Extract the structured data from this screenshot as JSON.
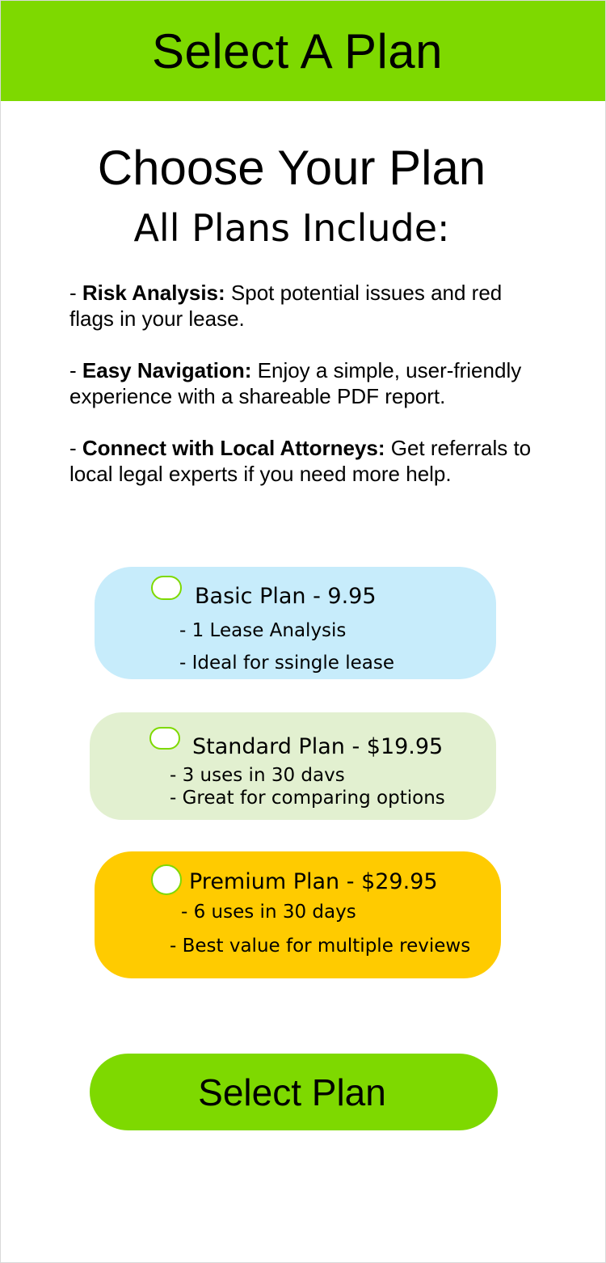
{
  "header": {
    "title": "Select A Plan"
  },
  "main": {
    "title": "Choose Your Plan",
    "subtitle": "All Plans Include:"
  },
  "features": [
    {
      "label": "Risk Analysis:",
      "text": "Spot potential issues and red flags in your lease."
    },
    {
      "label": "Easy Navigation:",
      "text": "Enjoy a simple, user-friendly experience with a shareable PDF report."
    },
    {
      "label": "Connect with Local Attorneys:",
      "text": "Get referrals to local legal experts if you need more help."
    }
  ],
  "plans": [
    {
      "name": "Basic Plan - 9.95",
      "lines": [
        "- 1 Lease Analysis",
        "- Ideal for ssingle lease"
      ],
      "color": "#c7ecfb",
      "selected": false
    },
    {
      "name": "Standard Plan - $19.95",
      "lines": [
        "- 3 uses in 30 davs",
        "- Great for comparing options"
      ],
      "color": "#e2f0d0",
      "selected": false
    },
    {
      "name": "Premium Plan - $29.95",
      "lines": [
        "- 6 uses in 30 days",
        "- Best value for multiple reviews"
      ],
      "color": "#ffcb00",
      "selected": false
    }
  ],
  "select_button": {
    "label": "Select Plan"
  },
  "colors": {
    "accent": "#7ed900",
    "radio_border": "#7ed900"
  }
}
